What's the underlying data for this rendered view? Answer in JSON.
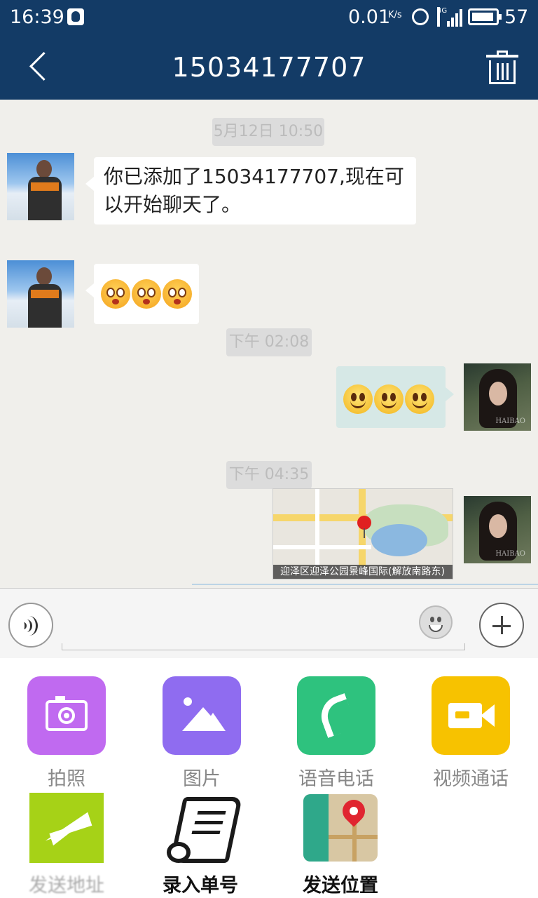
{
  "status_bar": {
    "time": "16:39",
    "net_speed": "0.01",
    "net_unit": "K/s",
    "network_type": "4G",
    "battery": "57"
  },
  "header": {
    "title": "15034177707"
  },
  "messages": [
    {
      "kind": "time",
      "text": "5月12日 10:50"
    },
    {
      "kind": "text",
      "side": "left",
      "text": "你已添加了15034177707,现在可以开始聊天了。"
    },
    {
      "kind": "emoji",
      "side": "left",
      "emoji": "shy-face",
      "count": 3
    },
    {
      "kind": "time",
      "text": "下午 02:08"
    },
    {
      "kind": "emoji",
      "side": "right",
      "emoji": "smile-face",
      "count": 3
    },
    {
      "kind": "time",
      "text": "下午 04:35"
    },
    {
      "kind": "location",
      "side": "right",
      "caption": "迎泽区迎泽公园景峰国际(解放南路东)"
    }
  ],
  "input_bar": {
    "value": "",
    "placeholder": ""
  },
  "actions": [
    {
      "label": "拍照",
      "icon": "camera-icon",
      "color": "#c06af0"
    },
    {
      "label": "图片",
      "icon": "picture-icon",
      "color": "#8f6cf0"
    },
    {
      "label": "语音电话",
      "icon": "phone-icon",
      "color": "#2ec27e"
    },
    {
      "label": "视频通话",
      "icon": "video-camera-icon",
      "color": "#f7c200"
    },
    {
      "label": "发送地址",
      "icon": "paper-plane-icon",
      "color": "#a6d217"
    },
    {
      "label": "录入单号",
      "icon": "receipt-icon",
      "color": "#ffffff"
    },
    {
      "label": "发送位置",
      "icon": "map-pin-book-icon",
      "color": "#2fa88a"
    }
  ]
}
